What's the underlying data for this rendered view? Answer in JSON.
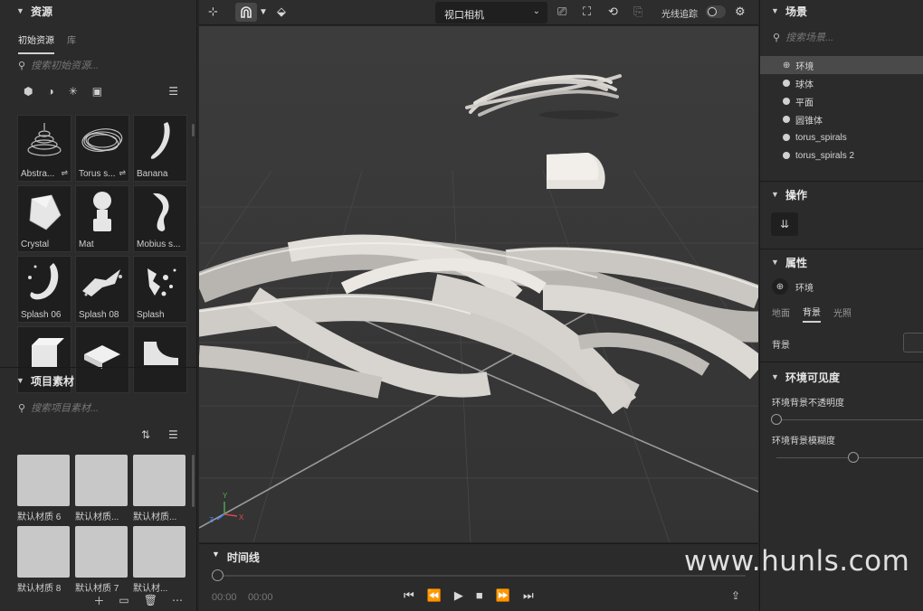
{
  "assets": {
    "title": "资源",
    "tabs": [
      {
        "label": "初始资源"
      },
      {
        "label": "库"
      }
    ],
    "search_placeholder": "搜索初始资源...",
    "items": [
      {
        "label": "Abstra..."
      },
      {
        "label": "Torus s..."
      },
      {
        "label": "Banana"
      },
      {
        "label": "Crystal"
      },
      {
        "label": "Mat"
      },
      {
        "label": "Mobius s..."
      },
      {
        "label": "Splash 06"
      },
      {
        "label": "Splash 08"
      },
      {
        "label": "Splash"
      },
      {
        "label": ""
      },
      {
        "label": ""
      },
      {
        "label": ""
      }
    ]
  },
  "project": {
    "title": "项目素材",
    "search_placeholder": "搜索项目素材...",
    "materials": [
      {
        "label": "默认材质 6"
      },
      {
        "label": "默认材质..."
      },
      {
        "label": "默认材质..."
      },
      {
        "label": "默认材质 8"
      },
      {
        "label": "默认材质 7"
      },
      {
        "label": "默认材..."
      }
    ]
  },
  "toolbar": {
    "camera": "视口相机",
    "raytrace_label": "光线追踪",
    "raytrace_on": false
  },
  "timeline": {
    "title": "时间线",
    "current_time": "00:00",
    "total_time": "00:00"
  },
  "scene": {
    "title": "场景",
    "search_placeholder": "搜索场景...",
    "items": [
      {
        "label": "环境",
        "selected": true
      },
      {
        "label": "球体"
      },
      {
        "label": "平面"
      },
      {
        "label": "圆锥体"
      },
      {
        "label": "torus_spirals"
      },
      {
        "label": "torus_spirals 2"
      }
    ]
  },
  "actions": {
    "title": "操作"
  },
  "properties": {
    "title": "属性",
    "object": "环境",
    "tabs": [
      {
        "label": "地面"
      },
      {
        "label": "背景",
        "active": true
      },
      {
        "label": "光照"
      }
    ],
    "background_label": "背景",
    "visibility_title": "环境可见度",
    "opacity_label": "环境背景不透明度",
    "opacity_value": 0,
    "blur_label": "环境背景模糊度",
    "blur_value": 0.52
  },
  "watermark": "www.hunls.com"
}
